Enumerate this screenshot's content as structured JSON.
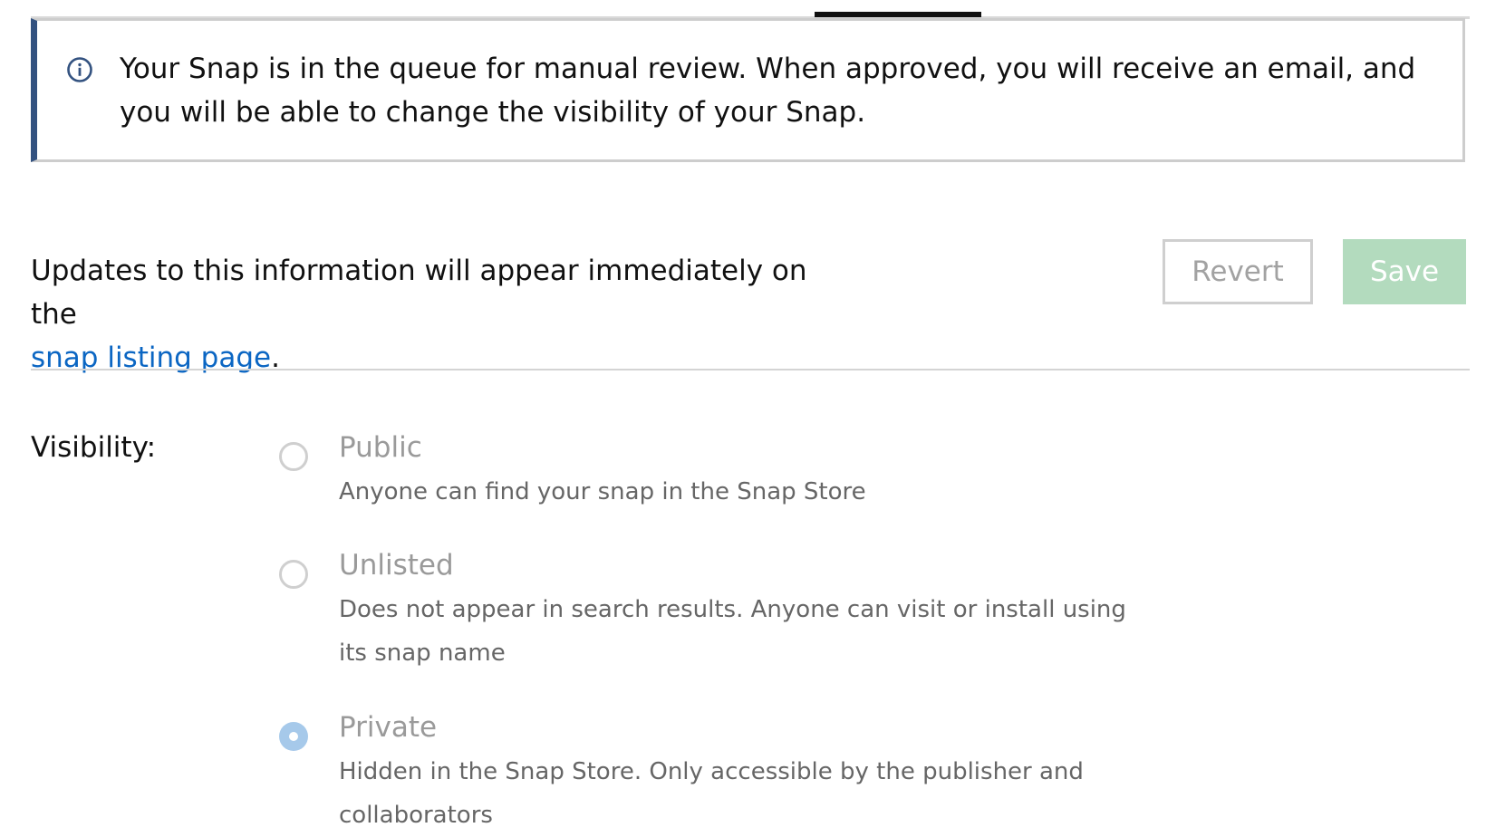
{
  "notice": {
    "icon": "info-icon",
    "accent_color": "#335280",
    "text": "Your Snap is in the queue for manual review. When approved, you will receive an email, and you will be able to change the visibility of your Snap."
  },
  "intro": {
    "text_before_link": "Updates to this information will appear immediately on the",
    "link_text": "snap listing page",
    "text_after_link": "."
  },
  "actions": {
    "revert_label": "Revert",
    "save_label": "Save",
    "save_color": "#b3dbbe"
  },
  "visibility": {
    "label": "Visibility:",
    "selected": "Private",
    "options": [
      {
        "label": "Public",
        "description": "Anyone can find your snap in the Snap Store",
        "checked": false
      },
      {
        "label": "Unlisted",
        "description": "Does not appear in search results. Anyone can visit or install using its snap name",
        "checked": false
      },
      {
        "label": "Private",
        "description": "Hidden in the Snap Store. Only accessible by the publisher and collaborators",
        "checked": true
      }
    ]
  }
}
